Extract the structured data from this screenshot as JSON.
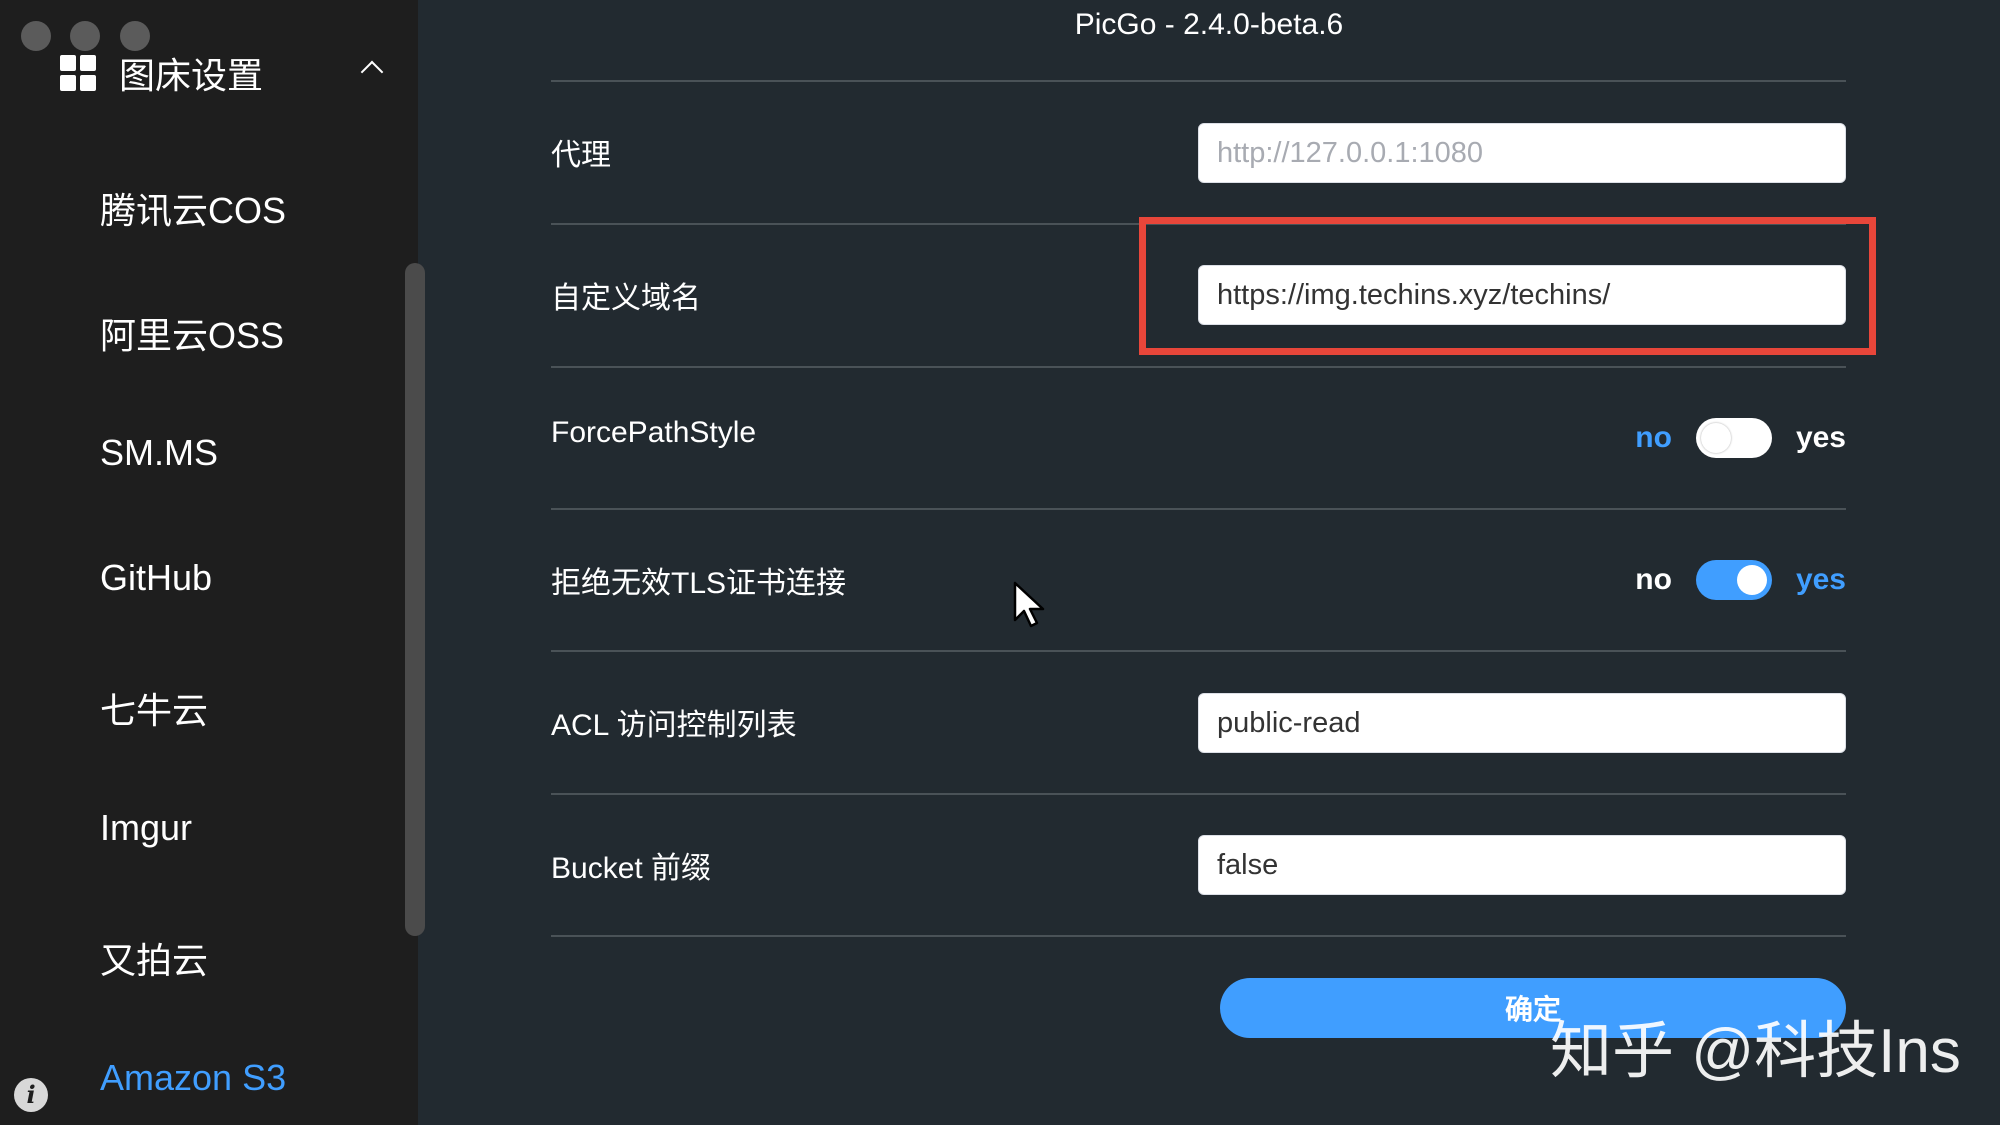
{
  "window": {
    "title": "PicGo - 2.4.0-beta.6"
  },
  "sidebar": {
    "group_title": "图床设置",
    "items": [
      {
        "label": "腾讯云COS",
        "active": false
      },
      {
        "label": "阿里云OSS",
        "active": false
      },
      {
        "label": "SM.MS",
        "active": false
      },
      {
        "label": "GitHub",
        "active": false
      },
      {
        "label": "七牛云",
        "active": false
      },
      {
        "label": "Imgur",
        "active": false
      },
      {
        "label": "又拍云",
        "active": false
      },
      {
        "label": "Amazon S3",
        "active": true
      }
    ]
  },
  "form": {
    "proxy": {
      "label": "代理",
      "value": "",
      "placeholder": "http://127.0.0.1:1080"
    },
    "custom_domain": {
      "label": "自定义域名",
      "value": "https://img.techins.xyz/techins/"
    },
    "force_path_style": {
      "label": "ForcePathStyle",
      "off_label": "no",
      "on_label": "yes",
      "checked": false
    },
    "reject_unauthorized": {
      "label": "拒绝无效TLS证书连接",
      "off_label": "no",
      "on_label": "yes",
      "checked": true
    },
    "acl": {
      "label": "ACL 访问控制列表",
      "value": "public-read"
    },
    "bucket_prefix": {
      "label": "Bucket 前缀",
      "value": "false"
    },
    "confirm_label": "确定"
  },
  "watermark": "知乎 @科技Ins",
  "colors": {
    "accent": "#409eff",
    "highlight": "#e8463a",
    "sidebar_bg": "#1e1e1e",
    "main_bg": "#222a30"
  },
  "icons": [
    "grid-icon",
    "chevron-up-icon",
    "info-icon",
    "cursor-icon"
  ]
}
